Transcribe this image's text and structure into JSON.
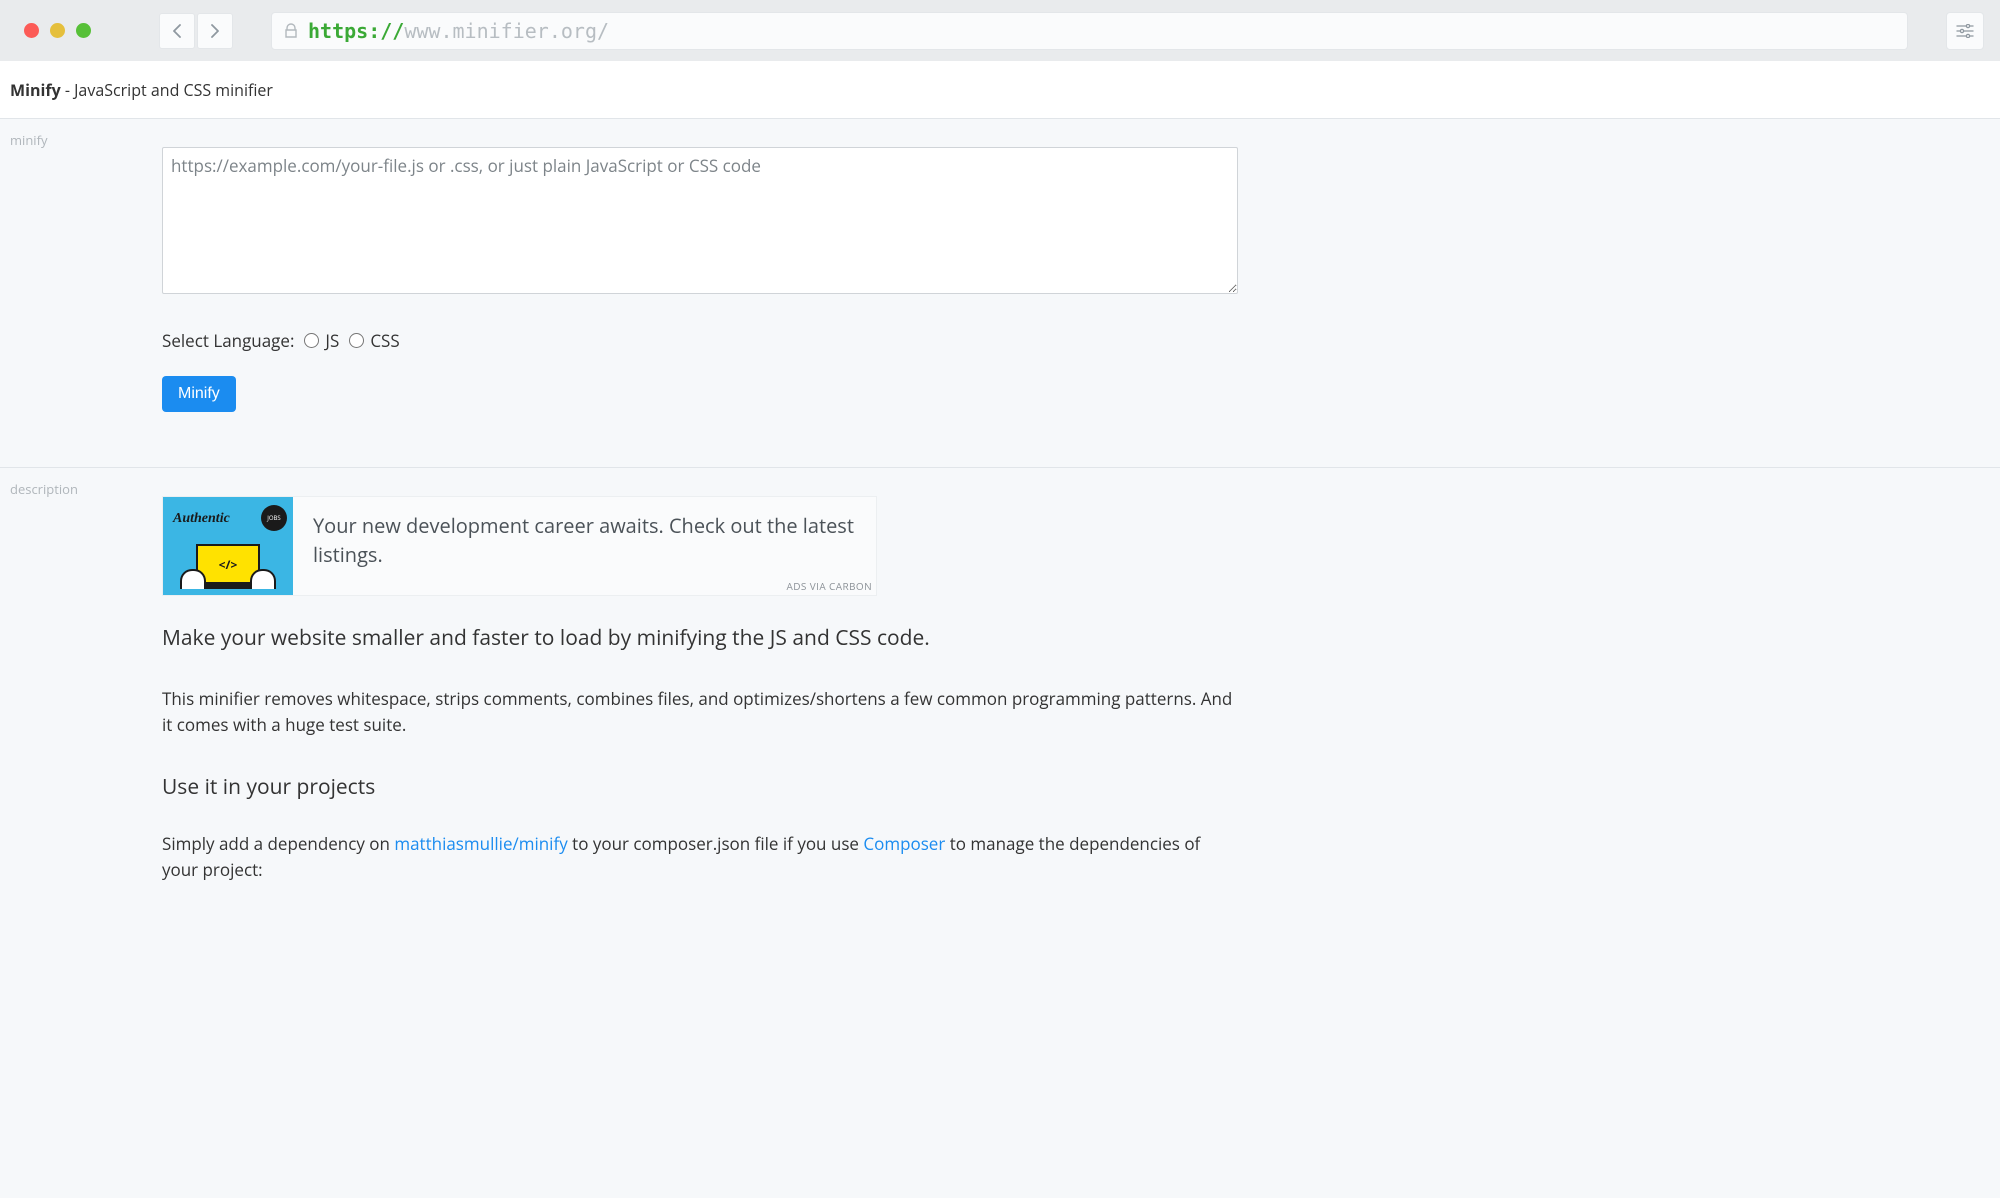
{
  "chrome": {
    "url_scheme": "https://",
    "url_rest": "www.minifier.org/"
  },
  "header": {
    "brand": "Minify",
    "tagline": " - JavaScript and CSS minifier"
  },
  "sections": {
    "minify_label": "minify",
    "description_label": "description"
  },
  "form": {
    "placeholder": "https://example.com/your-file.js or .css, or just plain JavaScript or CSS code",
    "select_language_label": "Select Language:",
    "lang_js": "JS",
    "lang_css": "CSS",
    "submit_label": "Minify"
  },
  "ad": {
    "logo_text": "Authentic",
    "badge": "JOBS",
    "code_glyph": "</>",
    "text": "Your new development career awaits. Check out the latest listings.",
    "via": "ADS VIA CARBON"
  },
  "description": {
    "lead": "Make your website smaller and faster to load by minifying the JS and CSS code.",
    "paragraph1": "This minifier removes whitespace, strips comments, combines files, and optimizes/shortens a few common programming patterns. And it comes with a huge test suite.",
    "subhead": "Use it in your projects",
    "paragraph2_prefix": "Simply add a dependency on ",
    "paragraph2_link": "matthiasmullie/minify",
    "paragraph2_mid": " to your composer.json file if you use ",
    "paragraph2_link2": "Composer",
    "paragraph2_suffix": " to manage the dependencies of your project:"
  }
}
